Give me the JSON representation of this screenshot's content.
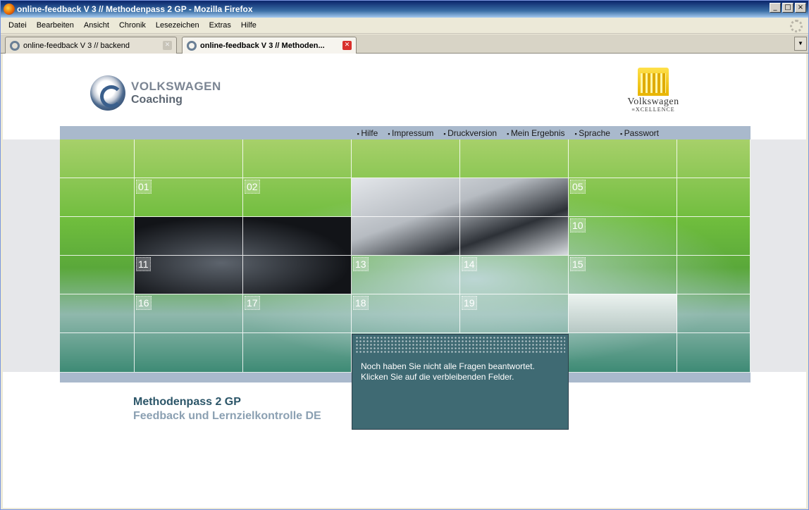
{
  "window": {
    "title": "online-feedback V 3 // Methodenpass 2 GP - Mozilla Firefox",
    "controls": [
      "_",
      "□",
      "×"
    ]
  },
  "menubar": [
    "Datei",
    "Bearbeiten",
    "Ansicht",
    "Chronik",
    "Lesezeichen",
    "Extras",
    "Hilfe"
  ],
  "tabs": [
    {
      "label": "online-feedback V 3 // backend",
      "active": false
    },
    {
      "label": "online-feedback V 3 // Methoden...",
      "active": true
    }
  ],
  "logos": {
    "coaching_line1": "VOLKSWAGEN",
    "coaching_line2": "Coaching",
    "excellence_line1": "Volkswagen",
    "excellence_line2": "≡XCELLENCE"
  },
  "nav": [
    "Hilfe",
    "Impressum",
    "Druckversion",
    "Mein Ergebnis",
    "Sprache",
    "Passwort"
  ],
  "grid_numbers": [
    "01",
    "02",
    "05",
    "10",
    "11",
    "13",
    "14",
    "15",
    "16",
    "17",
    "18",
    "19"
  ],
  "popup": {
    "line1": "Noch haben Sie nicht alle Fragen beantwortet.",
    "line2": "Klicken Sie auf die verbleibenden Felder."
  },
  "headings": {
    "title": "Methodenpass 2 GP",
    "subtitle": "Feedback und Lernzielkontrolle DE"
  }
}
